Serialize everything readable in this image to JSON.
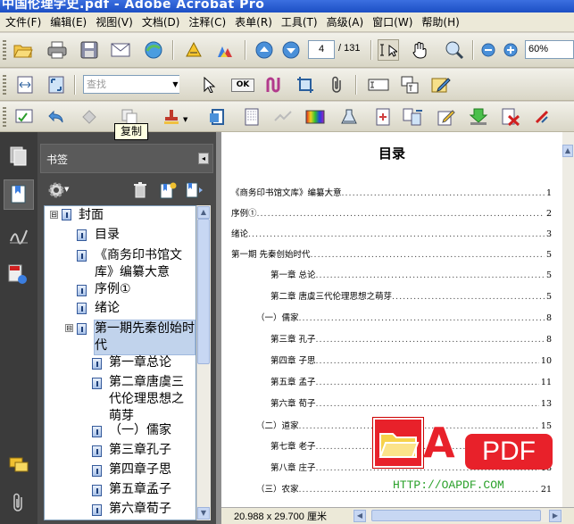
{
  "window": {
    "title": "中国伦理学史.pdf - Adobe Acrobat Pro"
  },
  "menu": [
    "文件(F)",
    "编辑(E)",
    "视图(V)",
    "文档(D)",
    "注释(C)",
    "表单(R)",
    "工具(T)",
    "高级(A)",
    "窗口(W)",
    "帮助(H)"
  ],
  "toolbar": {
    "page_current": "4",
    "page_total": "/ 131",
    "zoom": "60%",
    "search_placeholder": "查找",
    "ok_label": "OK",
    "tooltip": "复制"
  },
  "panel": {
    "title": "书签",
    "close_glyph": "◂"
  },
  "bookmarks": [
    {
      "label": "封面",
      "level": 0,
      "expander": "⊟"
    },
    {
      "label": "目录",
      "level": 1
    },
    {
      "label": "《商务印书馆文库》编纂大意",
      "level": 1
    },
    {
      "label": "序例①",
      "level": 1
    },
    {
      "label": "绪论",
      "level": 1
    },
    {
      "label": "第一期先秦创始时代",
      "level": 1,
      "selected": true,
      "expander": "⊟"
    },
    {
      "label": "第一章总论",
      "level": 2
    },
    {
      "label": "第二章唐虞三代伦理思想之萌芽",
      "level": 2
    },
    {
      "label": "（一）儒家",
      "level": 2
    },
    {
      "label": "第三章孔子",
      "level": 2
    },
    {
      "label": "第四章子思",
      "level": 2
    },
    {
      "label": "第五章孟子",
      "level": 2
    },
    {
      "label": "第六章荀子",
      "level": 2
    }
  ],
  "document": {
    "heading": "目录",
    "toc": [
      {
        "label": "《商务印书馆文库》编纂大意",
        "page": "1",
        "indent": 0
      },
      {
        "label": "序例①",
        "page": "2",
        "indent": 0
      },
      {
        "label": "绪论",
        "page": "3",
        "indent": 0
      },
      {
        "label": "第一期  先秦创始时代",
        "page": "5",
        "indent": 0
      },
      {
        "label": "第一章  总论",
        "page": "5",
        "indent": 2
      },
      {
        "label": "第二章  唐虞三代伦理思想之萌芽",
        "page": "5",
        "indent": 2
      },
      {
        "label": "（一）儒家",
        "page": "8",
        "indent": 1
      },
      {
        "label": "第三章  孔子",
        "page": "8",
        "indent": 2
      },
      {
        "label": "第四章  子思",
        "page": "10",
        "indent": 2
      },
      {
        "label": "第五章  孟子",
        "page": "11",
        "indent": 2
      },
      {
        "label": "第六章  荀子",
        "page": "13",
        "indent": 2
      },
      {
        "label": "（二）道家",
        "page": "15",
        "indent": 1
      },
      {
        "label": "第七章  老子",
        "page": "15",
        "indent": 2
      },
      {
        "label": "第八章  庄子",
        "page": "18",
        "indent": 2
      },
      {
        "label": "（三）农家",
        "page": "21",
        "indent": 1
      }
    ],
    "dots": "....................................................................................................................................."
  },
  "status": {
    "page_size": "20.988 x 29.700 厘米"
  },
  "watermark": {
    "letter": "A",
    "brand": "PDF",
    "url": "HTTP://OAPDF.COM"
  },
  "colors": {
    "accent": "#e8212a",
    "selection": "#c1d3ec",
    "titlebar": "#2a5fd6",
    "panel": "#4a4a4a"
  }
}
